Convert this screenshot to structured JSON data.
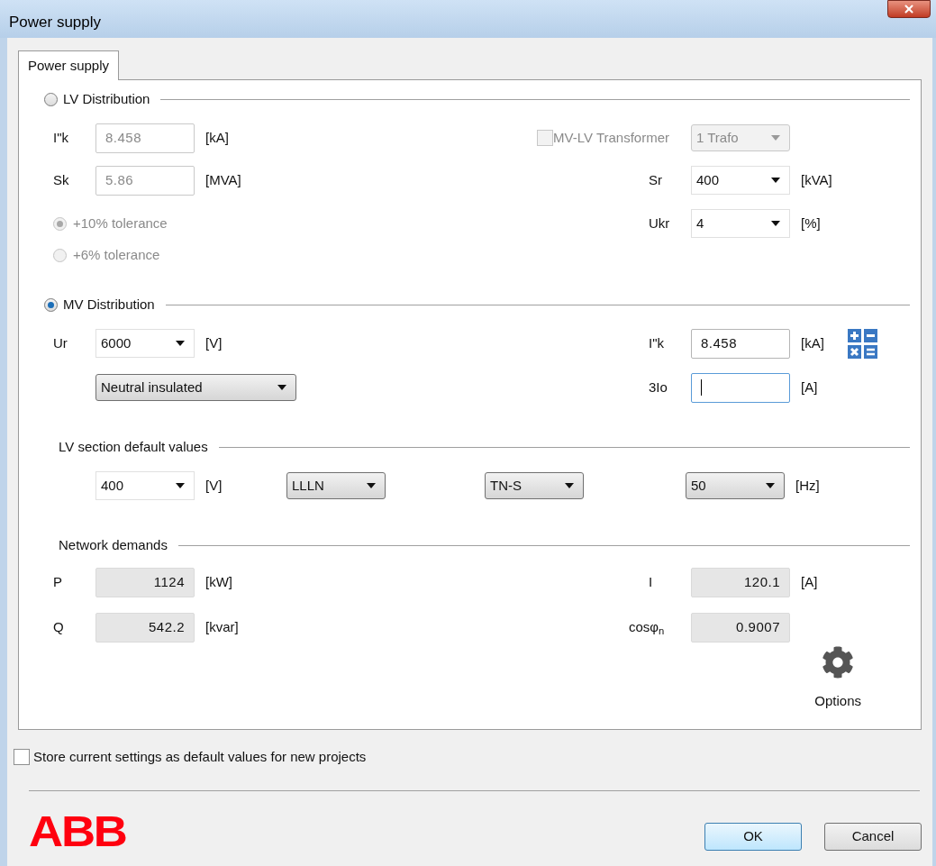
{
  "window": {
    "title": "Power supply"
  },
  "tabs": [
    {
      "label": "Power supply",
      "selected": true
    }
  ],
  "lv_distribution": {
    "label": "LV Distribution",
    "selected": false,
    "fields": [
      {
        "label": "I\"k",
        "value": "8.458",
        "unit": "[kA]",
        "disabled": true
      },
      {
        "label": "Sk",
        "value": "5.86",
        "unit": "[MVA]",
        "disabled": true
      }
    ],
    "tolerances": [
      {
        "label": "+10% tolerance",
        "selected": true,
        "disabled": true
      },
      {
        "label": "+6% tolerance",
        "selected": false,
        "disabled": true
      }
    ],
    "transformer": {
      "label": "MV-LV Transformer",
      "checked": false,
      "disabled": true,
      "value": "1 Trafo"
    },
    "sr": {
      "label": "Sr",
      "value": "400",
      "unit": "[kVA]"
    },
    "ukr": {
      "label": "Ukr",
      "value": "4",
      "unit": "[%]"
    }
  },
  "mv_distribution": {
    "label": "MV Distribution",
    "selected": true,
    "ur": {
      "label": "Ur",
      "value": "6000",
      "unit": "[V]"
    },
    "earthing": {
      "value": "Neutral insulated"
    },
    "ik": {
      "label": "I\"k",
      "value": "8.458",
      "unit": "[kA]"
    },
    "io": {
      "label": "3Io",
      "unit": "[A]",
      "focused": true
    }
  },
  "lv_defaults": {
    "label": "LV section default values",
    "items": [
      {
        "kind": "combo",
        "value": "400",
        "unit": "[V]"
      },
      {
        "kind": "button",
        "value": "LLLN"
      },
      {
        "kind": "button",
        "value": "TN-S"
      },
      {
        "kind": "button",
        "value": "50",
        "unit": "[Hz]"
      }
    ]
  },
  "network_demands": {
    "label": "Network demands",
    "rows": [
      {
        "left": {
          "label": "P",
          "value": "1124",
          "unit": "[kW]"
        },
        "right": {
          "label": "I",
          "value": "120.1",
          "unit": "[A]"
        }
      },
      {
        "left": {
          "label": "Q",
          "value": "542.2",
          "unit": "[kvar]"
        },
        "right": {
          "label": "cosφ$_{n}$",
          "value": "0.9007"
        }
      }
    ]
  },
  "options": {
    "label": "Options"
  },
  "store_default": {
    "label": "Store current settings as default values for new projects",
    "checked": false
  },
  "logo": "ABB",
  "buttons": [
    {
      "label": "OK",
      "default": true
    },
    {
      "label": "Cancel",
      "default": false
    }
  ]
}
